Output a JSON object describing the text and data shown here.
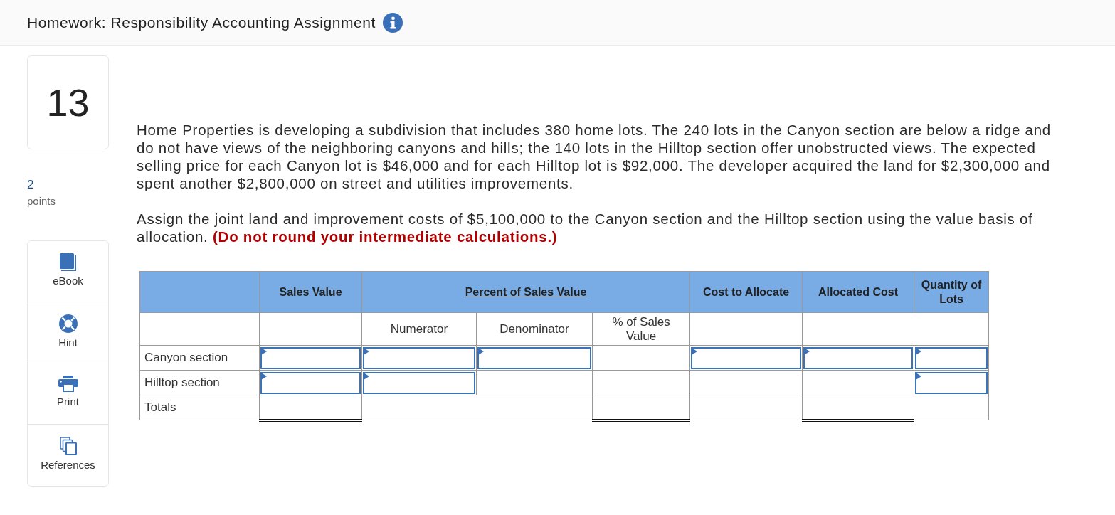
{
  "header": {
    "title": "Homework: Responsibility Accounting Assignment"
  },
  "question": {
    "number": "13",
    "points": "2",
    "points_label": "points"
  },
  "tools": [
    {
      "kind": "ebook",
      "label": "eBook"
    },
    {
      "kind": "hint",
      "label": "Hint"
    },
    {
      "kind": "print",
      "label": "Print"
    },
    {
      "kind": "references",
      "label": "References"
    }
  ],
  "problem": {
    "paragraphs": [
      "Home Properties is developing a subdivision that includes 380 home lots. The 240 lots in the Canyon section are below a ridge and do not have views of the neighboring canyons and hills; the 140 lots in the Hilltop section offer unobstructed views. The expected selling price for each Canyon lot is $46,000 and for each Hilltop lot is $92,000. The developer acquired the land for $2,300,000 and spent another $2,800,000 on street and utilities improvements.",
      "Assign the joint land and improvement costs of $5,100,000 to the Canyon section and the Hilltop section using the value basis of allocation. **(Do not round your intermediate calculations.)**"
    ]
  },
  "table": {
    "header": [
      {
        "kind": "blank"
      },
      {
        "kind": "head",
        "label": "Sales Value"
      },
      {
        "kind": "group",
        "label": "Percent of Sales Value"
      },
      {
        "kind": "head",
        "label": "Cost to Allocate"
      },
      {
        "kind": "head",
        "label": "Allocated Cost"
      },
      {
        "kind": "head",
        "label": "Quantity of Lots"
      }
    ],
    "subheader": [
      {
        "kind": "blank"
      },
      {
        "kind": "blank"
      },
      {
        "kind": "sub",
        "label": "Numerator"
      },
      {
        "kind": "sub",
        "label": "Denominator"
      },
      {
        "kind": "sub",
        "label": "% of Sales Value"
      },
      {
        "kind": "blank"
      },
      {
        "kind": "blank"
      },
      {
        "kind": "blank"
      }
    ],
    "rows": [
      {
        "cells": [
          {
            "kind": "label",
            "text": "Canyon section"
          },
          {
            "kind": "input"
          },
          {
            "kind": "input"
          },
          {
            "kind": "input"
          },
          {
            "kind": "blank"
          },
          {
            "kind": "input"
          },
          {
            "kind": "input"
          },
          {
            "kind": "input"
          }
        ]
      },
      {
        "cells": [
          {
            "kind": "label",
            "text": "Hilltop section"
          },
          {
            "kind": "input"
          },
          {
            "kind": "input"
          },
          {
            "kind": "blank"
          },
          {
            "kind": "blank"
          },
          {
            "kind": "blank"
          },
          {
            "kind": "blank"
          },
          {
            "kind": "input"
          }
        ]
      },
      {
        "cells": [
          {
            "kind": "label",
            "text": "Totals"
          },
          {
            "kind": "total"
          },
          {
            "kind": "wide"
          },
          {
            "kind": "total"
          },
          {
            "kind": "blank"
          },
          {
            "kind": "total"
          },
          {
            "kind": "blank"
          }
        ]
      }
    ]
  }
}
